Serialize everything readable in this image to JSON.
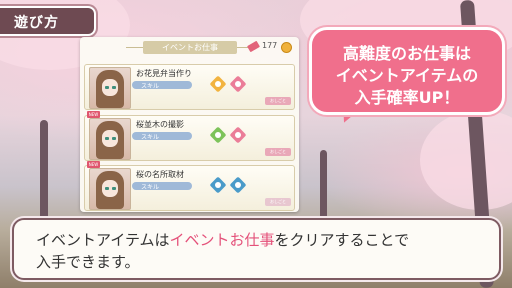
{
  "title": "遊び方",
  "panel": {
    "header_label": "イベントお仕事",
    "coin_count": "177",
    "jobs": [
      {
        "title": "お花見弁当作り",
        "skill_label": "スキル",
        "skill_icons": [
          "orange",
          "pink"
        ],
        "badge": "",
        "button": "おしごと"
      },
      {
        "title": "桜並木の撮影",
        "skill_label": "スキル",
        "skill_icons": [
          "green",
          "pink"
        ],
        "badge": "NEW",
        "button": "おしごと"
      },
      {
        "title": "桜の名所取材",
        "skill_label": "スキル",
        "skill_icons": [
          "blue",
          "blue"
        ],
        "badge": "NEW",
        "button": "おしごと"
      }
    ]
  },
  "bubble": {
    "line1": "高難度のお仕事は",
    "line2": "イベントアイテムの",
    "line3": "入手確率UP！"
  },
  "textbox": {
    "line1_pre": "イベントアイテムは",
    "line1_highlight": "イベントお仕事",
    "line1_post": "をクリアすることで",
    "line2": "入手できます。"
  },
  "colors": {
    "accent_pink": "#f06f8c",
    "highlight": "#e4517a",
    "title_bg": "#6e4a52"
  }
}
